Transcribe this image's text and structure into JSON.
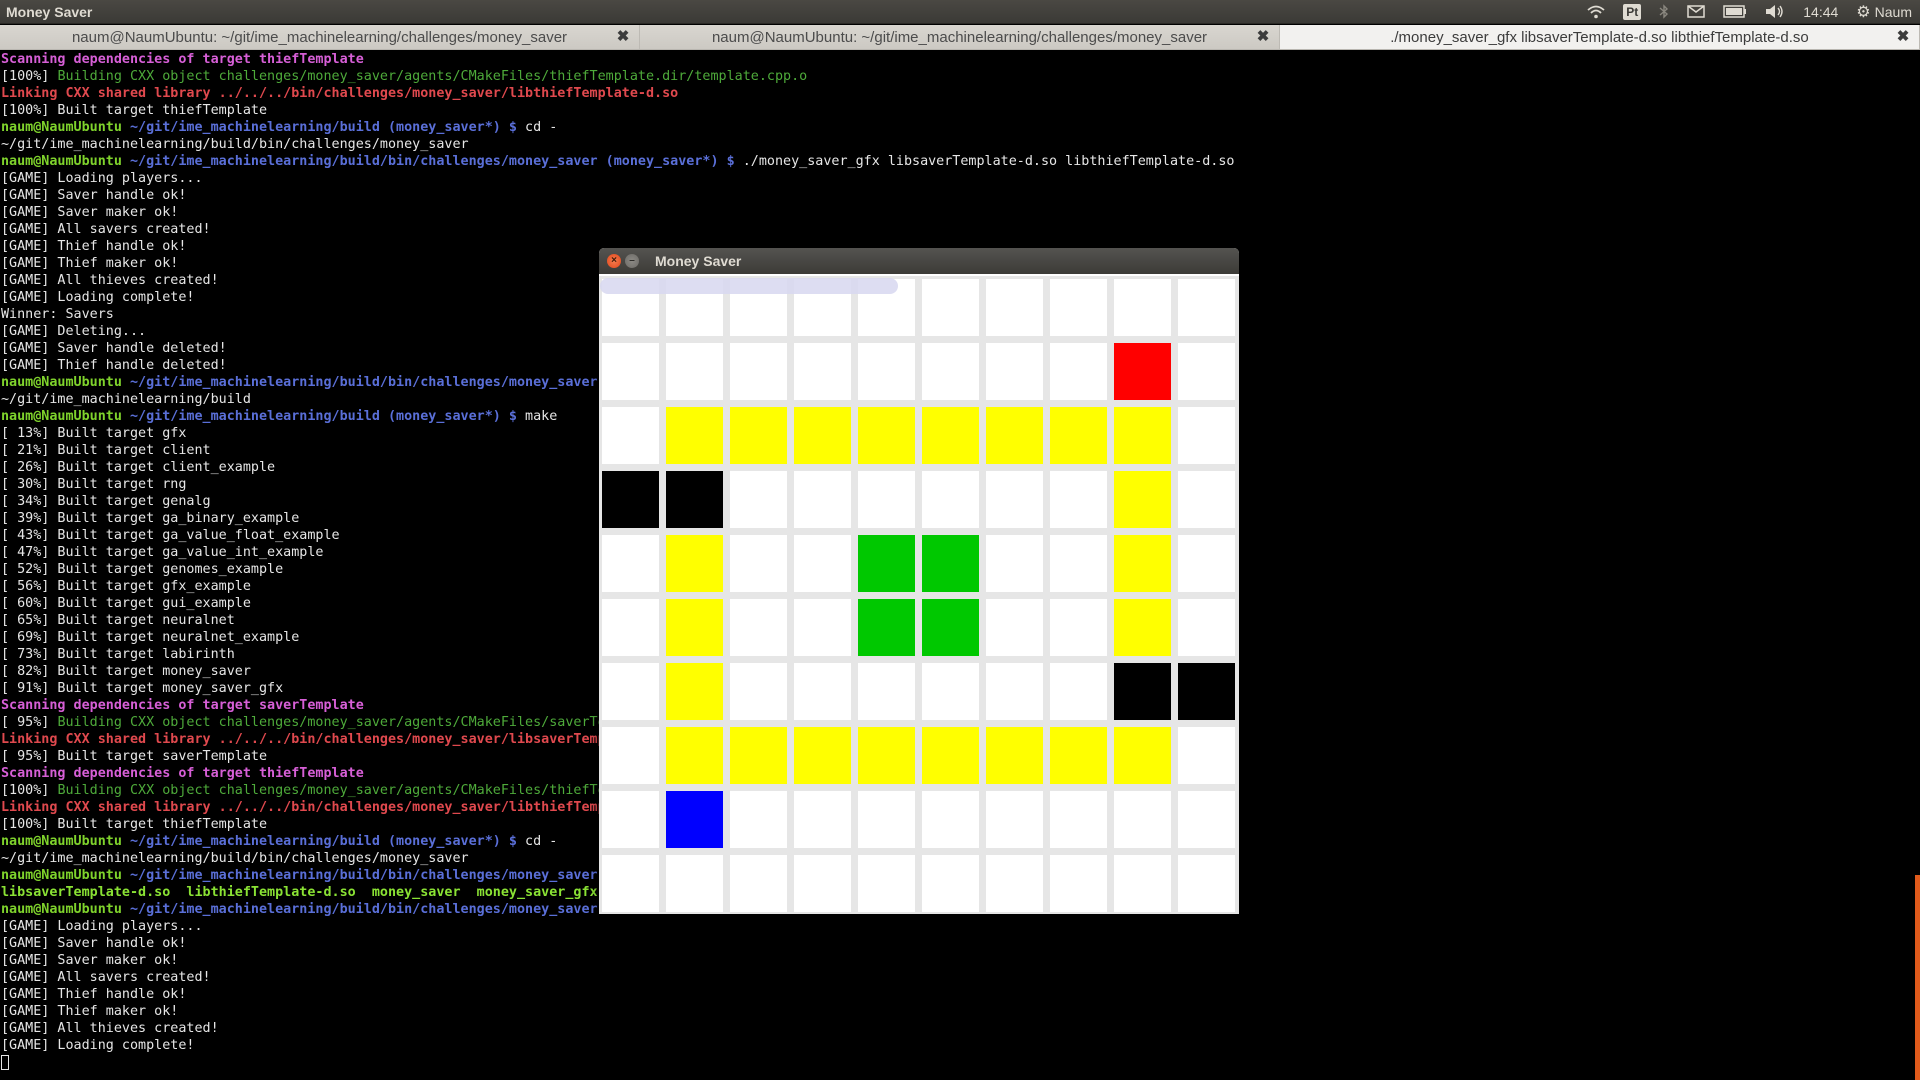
{
  "top_panel": {
    "app_title": "Money Saver",
    "keyboard_layout": "Pt",
    "clock": "14:44",
    "user": "Naum"
  },
  "tabs": [
    {
      "label": "naum@NaumUbuntu: ~/git/ime_machinelearning/challenges/money_saver",
      "active": false
    },
    {
      "label": "naum@NaumUbuntu: ~/git/ime_machinelearning/challenges/money_saver",
      "active": false
    },
    {
      "label": "./money_saver_gfx libsaverTemplate-d.so libthiefTemplate-d.so",
      "active": true
    }
  ],
  "terminal_lines": [
    [
      {
        "t": "Scanning dependencies of target thiefTemplate",
        "c": "magenta"
      }
    ],
    [
      {
        "t": "[100%] ",
        "c": "white"
      },
      {
        "t": "Building CXX object challenges/money_saver/agents/CMakeFiles/thiefTemplate.dir/template.cpp.o",
        "c": "green"
      }
    ],
    [
      {
        "t": "Linking CXX shared library ../../../bin/challenges/money_saver/libthiefTemplate-d.so",
        "c": "red"
      }
    ],
    [
      {
        "t": "[100%] Built target thiefTemplate",
        "c": "white"
      }
    ],
    [
      {
        "t": "naum@NaumUbuntu",
        "c": "user"
      },
      {
        "t": " ~/git/ime_machinelearning/build (money_saver*) $",
        "c": "path"
      },
      {
        "t": " cd -",
        "c": "white"
      }
    ],
    [
      {
        "t": "~/git/ime_machinelearning/build/bin/challenges/money_saver",
        "c": "white"
      }
    ],
    [
      {
        "t": "naum@NaumUbuntu",
        "c": "user"
      },
      {
        "t": " ~/git/ime_machinelearning/build/bin/challenges/money_saver (money_saver*) $",
        "c": "path"
      },
      {
        "t": " ./money_saver_gfx libsaverTemplate-d.so libthiefTemplate-d.so",
        "c": "white"
      }
    ],
    [
      {
        "t": "[GAME] Loading players...",
        "c": "white"
      }
    ],
    [
      {
        "t": "[GAME] Saver handle ok!",
        "c": "white"
      }
    ],
    [
      {
        "t": "[GAME] Saver maker ok!",
        "c": "white"
      }
    ],
    [
      {
        "t": "[GAME] All savers created!",
        "c": "white"
      }
    ],
    [
      {
        "t": "[GAME] Thief handle ok!",
        "c": "white"
      }
    ],
    [
      {
        "t": "[GAME] Thief maker ok!",
        "c": "white"
      }
    ],
    [
      {
        "t": "[GAME] All thieves created!",
        "c": "white"
      }
    ],
    [
      {
        "t": "[GAME] Loading complete!",
        "c": "white"
      }
    ],
    [
      {
        "t": "Winner: Savers",
        "c": "white"
      }
    ],
    [
      {
        "t": "[GAME] Deleting...",
        "c": "white"
      }
    ],
    [
      {
        "t": "[GAME] Saver handle deleted!",
        "c": "white"
      }
    ],
    [
      {
        "t": "[GAME] Thief handle deleted!",
        "c": "white"
      }
    ],
    [
      {
        "t": "naum@NaumUbuntu",
        "c": "user"
      },
      {
        "t": " ~/git/ime_machinelearning/build/bin/challenges/money_saver",
        "c": "path"
      }
    ],
    [
      {
        "t": "~/git/ime_machinelearning/build",
        "c": "white"
      }
    ],
    [
      {
        "t": "naum@NaumUbuntu",
        "c": "user"
      },
      {
        "t": " ~/git/ime_machinelearning/build (money_saver*) $",
        "c": "path"
      },
      {
        "t": " make",
        "c": "white"
      }
    ],
    [
      {
        "t": "[ 13%] Built target gfx",
        "c": "white"
      }
    ],
    [
      {
        "t": "[ 21%] Built target client",
        "c": "white"
      }
    ],
    [
      {
        "t": "[ 26%] Built target client_example",
        "c": "white"
      }
    ],
    [
      {
        "t": "[ 30%] Built target rng",
        "c": "white"
      }
    ],
    [
      {
        "t": "[ 34%] Built target genalg",
        "c": "white"
      }
    ],
    [
      {
        "t": "[ 39%] Built target ga_binary_example",
        "c": "white"
      }
    ],
    [
      {
        "t": "[ 43%] Built target ga_value_float_example",
        "c": "white"
      }
    ],
    [
      {
        "t": "[ 47%] Built target ga_value_int_example",
        "c": "white"
      }
    ],
    [
      {
        "t": "[ 52%] Built target genomes_example",
        "c": "white"
      }
    ],
    [
      {
        "t": "[ 56%] Built target gfx_example",
        "c": "white"
      }
    ],
    [
      {
        "t": "[ 60%] Built target gui_example",
        "c": "white"
      }
    ],
    [
      {
        "t": "[ 65%] Built target neuralnet",
        "c": "white"
      }
    ],
    [
      {
        "t": "[ 69%] Built target neuralnet_example",
        "c": "white"
      }
    ],
    [
      {
        "t": "[ 73%] Built target labirinth",
        "c": "white"
      }
    ],
    [
      {
        "t": "[ 82%] Built target money_saver",
        "c": "white"
      }
    ],
    [
      {
        "t": "[ 91%] Built target money_saver_gfx",
        "c": "white"
      }
    ],
    [
      {
        "t": "Scanning dependencies of target saverTemplate",
        "c": "magenta"
      }
    ],
    [
      {
        "t": "[ 95%] ",
        "c": "white"
      },
      {
        "t": "Building CXX object challenges/money_saver/agents/CMakeFiles/saverTe",
        "c": "green"
      }
    ],
    [
      {
        "t": "Linking CXX shared library ../../../bin/challenges/money_saver/libsaverTemp",
        "c": "red"
      }
    ],
    [
      {
        "t": "[ 95%] Built target saverTemplate",
        "c": "white"
      }
    ],
    [
      {
        "t": "Scanning dependencies of target thiefTemplate",
        "c": "magenta"
      }
    ],
    [
      {
        "t": "[100%] ",
        "c": "white"
      },
      {
        "t": "Building CXX object challenges/money_saver/agents/CMakeFiles/thiefTe",
        "c": "green"
      }
    ],
    [
      {
        "t": "Linking CXX shared library ../../../bin/challenges/money_saver/libthiefTemp",
        "c": "red"
      }
    ],
    [
      {
        "t": "[100%] Built target thiefTemplate",
        "c": "white"
      }
    ],
    [
      {
        "t": "naum@NaumUbuntu",
        "c": "user"
      },
      {
        "t": " ~/git/ime_machinelearning/build (money_saver*) $",
        "c": "path"
      },
      {
        "t": " cd -",
        "c": "white"
      }
    ],
    [
      {
        "t": "~/git/ime_machinelearning/build/bin/challenges/money_saver",
        "c": "white"
      }
    ],
    [
      {
        "t": "naum@NaumUbuntu",
        "c": "user"
      },
      {
        "t": " ~/git/ime_machinelearning/build/bin/challenges/money_saver",
        "c": "path"
      }
    ],
    [
      {
        "t": "libsaverTemplate-d.so  libthiefTemplate-d.so  money_saver  money_saver_gfx",
        "c": "bgreen"
      }
    ],
    [
      {
        "t": "naum@NaumUbuntu",
        "c": "user"
      },
      {
        "t": " ~/git/ime_machinelearning/build/bin/challenges/money_saver",
        "c": "path"
      }
    ],
    [
      {
        "t": "[GAME] Loading players...",
        "c": "white"
      }
    ],
    [
      {
        "t": "[GAME] Saver handle ok!",
        "c": "white"
      }
    ],
    [
      {
        "t": "[GAME] Saver maker ok!",
        "c": "white"
      }
    ],
    [
      {
        "t": "[GAME] All savers created!",
        "c": "white"
      }
    ],
    [
      {
        "t": "[GAME] Thief handle ok!",
        "c": "white"
      }
    ],
    [
      {
        "t": "[GAME] Thief maker ok!",
        "c": "white"
      }
    ],
    [
      {
        "t": "[GAME] All thieves created!",
        "c": "white"
      }
    ],
    [
      {
        "t": "[GAME] Loading complete!",
        "c": "white"
      }
    ]
  ],
  "game_window": {
    "title": "Money Saver",
    "grid_cols": 10,
    "grid_rows": 10,
    "grid": [
      "WWWWWWWWWW",
      "WWWWWWWWRW",
      "WYYYYYYYYW",
      "KKWWWWWWYW",
      "WYWWGGWWYW",
      "WYWWGGWWYW",
      "WYWWWWWWKK",
      "WYYYYYYYYW",
      "WBWWWWWWWW",
      "WWWWWWWWWW"
    ],
    "legend_colors": {
      "W": "#ffffff",
      "Y": "#ffff00",
      "R": "#ff0000",
      "K": "#000000",
      "G": "#00c800",
      "B": "#0000ff"
    }
  }
}
